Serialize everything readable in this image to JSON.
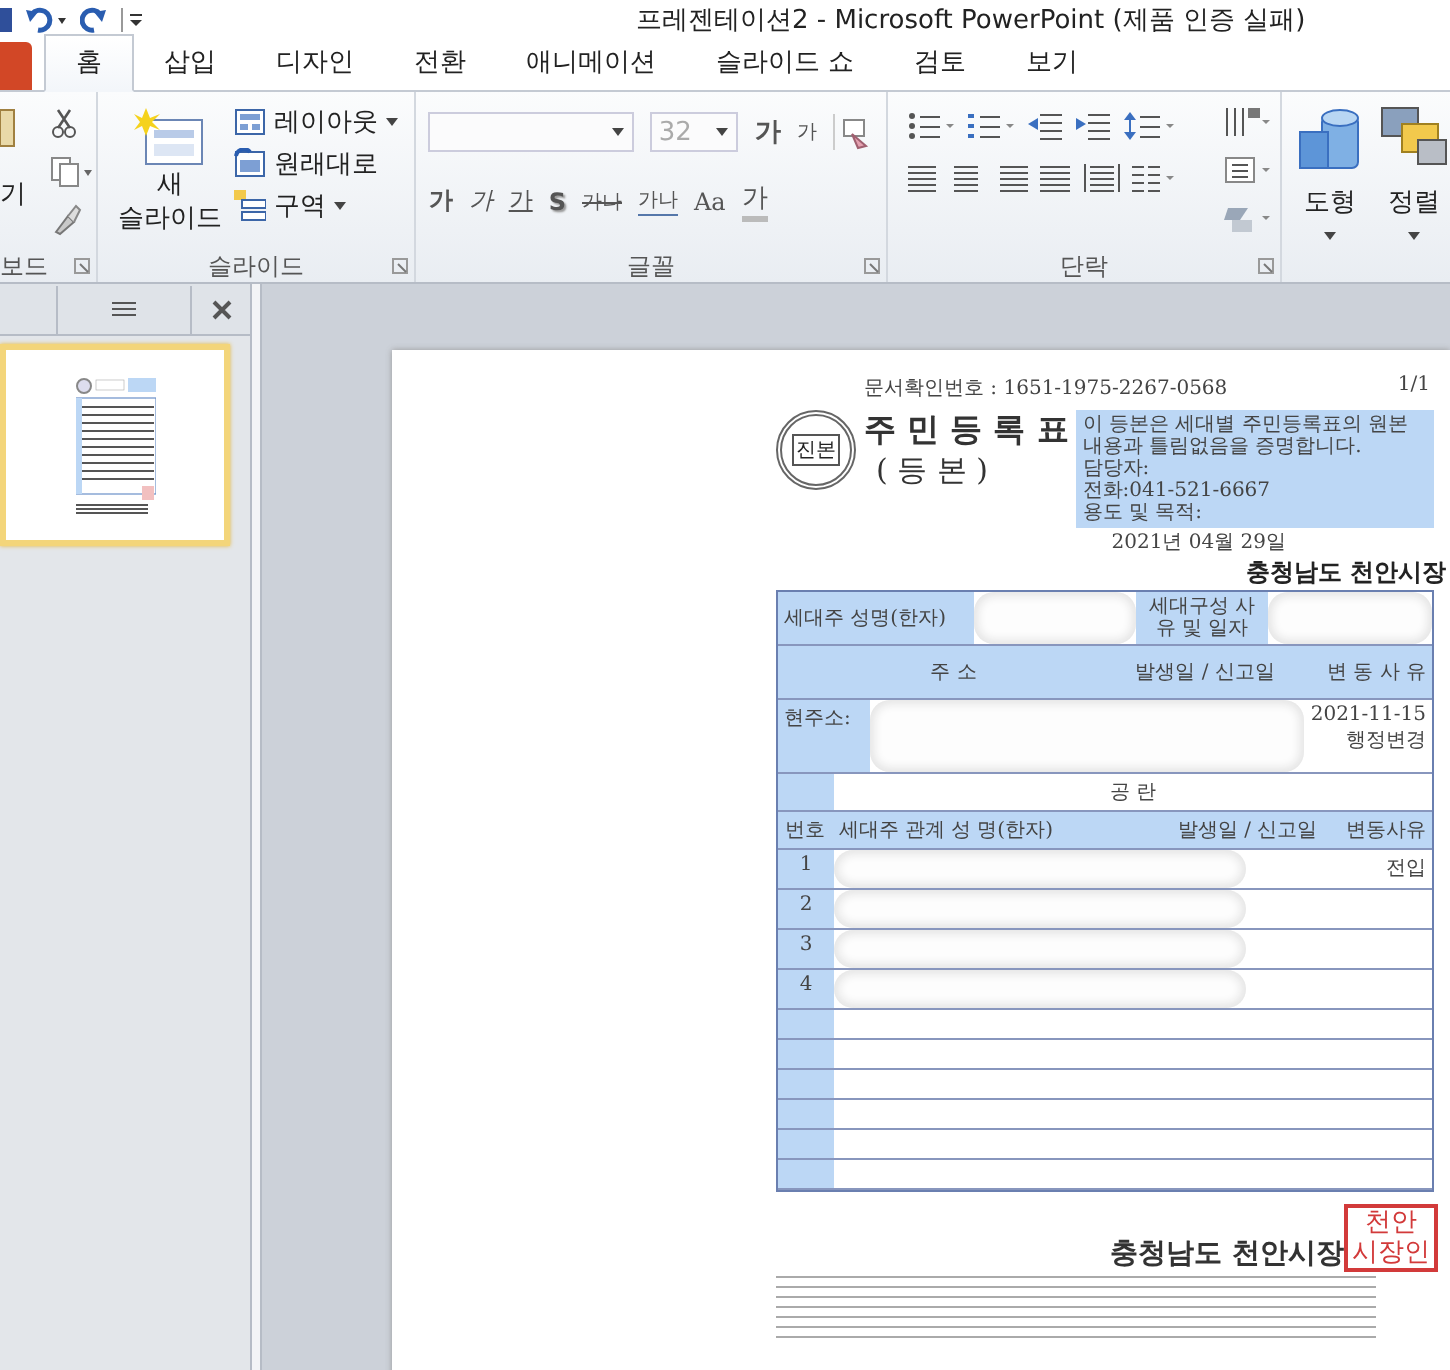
{
  "window": {
    "title": "프레젠테이션2  -  Microsoft PowerPoint (제품 인증 실패)"
  },
  "tabs": [
    {
      "label": "홈",
      "selected": true
    },
    {
      "label": "삽입",
      "selected": false
    },
    {
      "label": "디자인",
      "selected": false
    },
    {
      "label": "전환",
      "selected": false
    },
    {
      "label": "애니메이션",
      "selected": false
    },
    {
      "label": "슬라이드 쇼",
      "selected": false
    },
    {
      "label": "검토",
      "selected": false
    },
    {
      "label": "보기",
      "selected": false
    }
  ],
  "ribbon": {
    "clipboard": {
      "paste_label": "기",
      "group_label": "보드"
    },
    "slides": {
      "new_slide": [
        "새",
        "슬라이드"
      ],
      "items": [
        "레이아웃",
        "원래대로",
        "구역"
      ],
      "group_label": "슬라이드"
    },
    "font": {
      "font_size": "32",
      "size_disabled": true,
      "grow": "가",
      "shrink": "가",
      "format_buttons": [
        {
          "kind": "bold",
          "label": "가"
        },
        {
          "kind": "italic",
          "label": "가"
        },
        {
          "kind": "underline",
          "label": "가"
        },
        {
          "kind": "shadow",
          "label": "S"
        },
        {
          "kind": "strike",
          "label": "가나"
        },
        {
          "kind": "spacing",
          "label": "가나"
        },
        {
          "kind": "case",
          "label": "Aa"
        },
        {
          "kind": "color",
          "label": "가"
        }
      ],
      "group_label": "글꼴"
    },
    "paragraph": {
      "group_label": "단락"
    },
    "drawing": {
      "buttons": [
        "도형",
        "정렬"
      ]
    }
  },
  "thumbnails": [
    {
      "selected": true
    }
  ],
  "document": {
    "confirmation_number": "문서확인번호 : 1651-1975-2267-0568",
    "page": "1/1",
    "seal_text": "진본",
    "title": "주 민 등 록 표",
    "subtitle": "( 등 본 )",
    "certificate": {
      "statement": "이 등본은 세대별 주민등록표의 원본 내용과 틀림없음을 증명합니다.",
      "lines": [
        "담당자:",
        "전화:041-521-6667",
        "용도 및 목적:"
      ]
    },
    "date": "2021년 04월 29일",
    "issuer": "충청남도 천안시장",
    "household": {
      "head_label": "세대주 성명(한자)",
      "composition_label": "세대구성 사유 및 일자"
    },
    "address_header": {
      "address": "주 소",
      "date": "발생일 / 신고일",
      "reason": "변 동 사 유"
    },
    "current_address": {
      "label": "현주소:",
      "date": "2021-11-15",
      "reason": "행정변경"
    },
    "blank_text": "공 란",
    "members_header": [
      "번호",
      "세대주 관계",
      "성 명(한자)",
      "발생일 / 신고일",
      "변동사유"
    ],
    "members": [
      {
        "number": "1",
        "reason": "전입"
      },
      {
        "number": "2"
      },
      {
        "number": "3"
      },
      {
        "number": "4"
      }
    ],
    "footer_issuer": "충청남도 천안시장",
    "stamp_lines": [
      "천안",
      "시장인"
    ]
  }
}
